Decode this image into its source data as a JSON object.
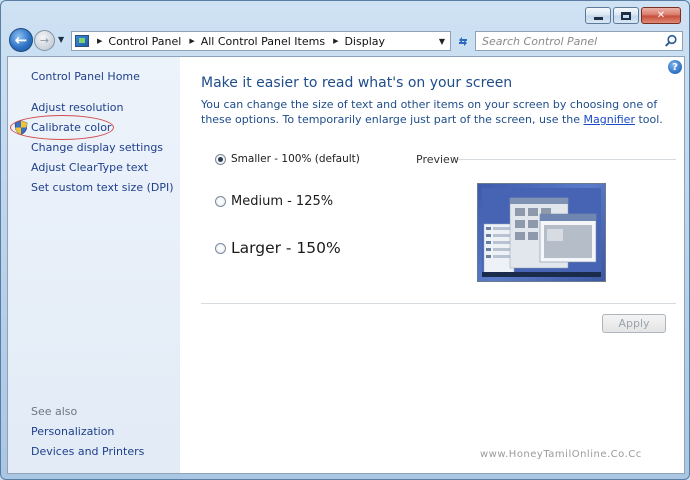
{
  "address_bar": {
    "breadcrumbs": [
      "Control Panel",
      "All Control Panel Items",
      "Display"
    ]
  },
  "search": {
    "placeholder": "Search Control Panel"
  },
  "sidebar": {
    "home": "Control Panel Home",
    "links": [
      "Adjust resolution",
      "Calibrate color",
      "Change display settings",
      "Adjust ClearType text",
      "Set custom text size (DPI)"
    ],
    "see_also_label": "See also",
    "see_also": [
      "Personalization",
      "Devices and Printers"
    ]
  },
  "main": {
    "title": "Make it easier to read what's on your screen",
    "description_pre": "You can change the size of text and other items on your screen by choosing one of these options. To temporarily enlarge just part of the screen, use the ",
    "magnifier_link": "Magnifier",
    "description_post": " tool.",
    "options": [
      {
        "label": "Smaller - 100% (default)",
        "checked": true
      },
      {
        "label": "Medium - 125%",
        "checked": false
      },
      {
        "label": "Larger - 150%",
        "checked": false
      }
    ],
    "preview_label": "Preview",
    "apply_label": "Apply"
  },
  "watermark": "www.HoneyTamilOnline.Co.Cc",
  "colors": {
    "link": "#1e3f8a",
    "title": "#1f4d8c",
    "annotation": "#d24d4d"
  },
  "icons": [
    "back-arrow-icon",
    "forward-arrow-icon",
    "control-panel-icon",
    "refresh-icon",
    "search-icon",
    "help-icon",
    "shield-icon"
  ]
}
